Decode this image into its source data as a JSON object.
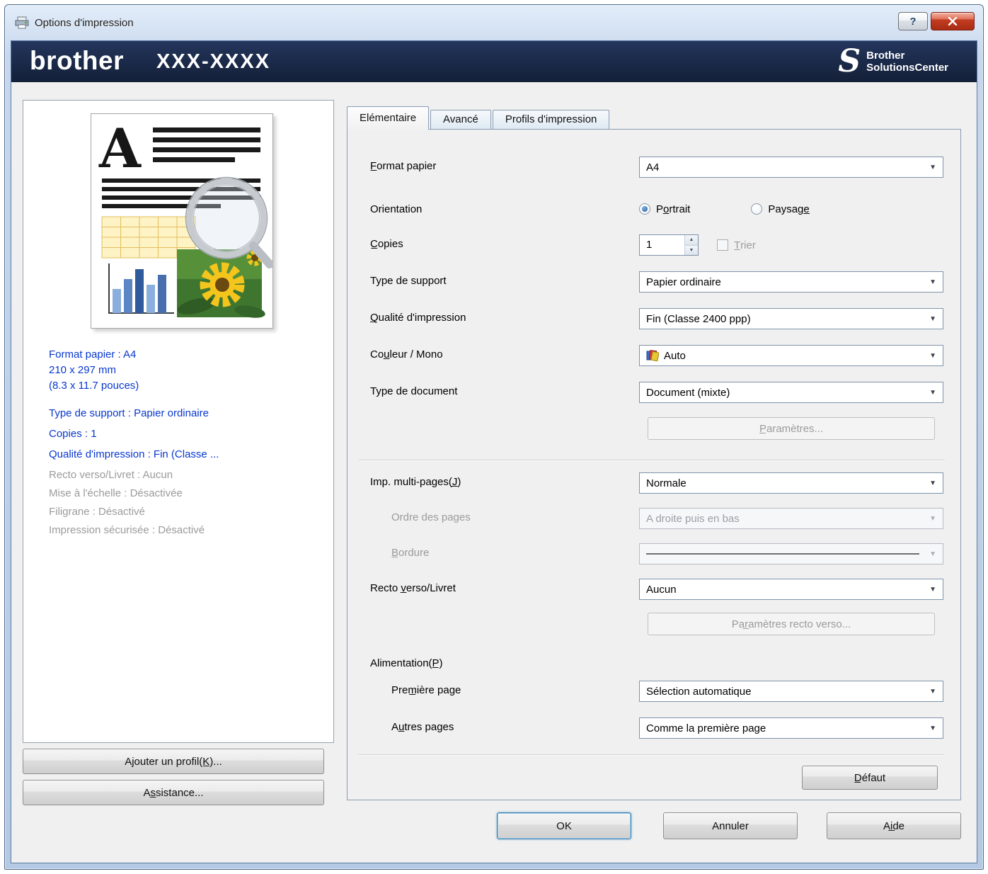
{
  "window": {
    "title": "Options d'impression",
    "help_glyph": "?"
  },
  "icons": {
    "close": "✕",
    "chevron_down": "▼",
    "spinner_up": "▲",
    "spinner_down": "▼"
  },
  "header": {
    "brand": "brother",
    "model": "XXX-XXXX",
    "s_mark": "S",
    "solutions_line1": "Brother",
    "solutions_line2": "SolutionsCenter",
    "band_color": "#1a2948"
  },
  "preview": {
    "info": [
      {
        "text": "Format papier : A4",
        "muted": false
      },
      {
        "text": "210 x 297 mm",
        "muted": false
      },
      {
        "text": "(8.3 x 11.7 pouces)",
        "muted": false
      },
      {
        "text": "Type de support : Papier ordinaire",
        "muted": false
      },
      {
        "text": "Copies : 1",
        "muted": false
      },
      {
        "text": "Qualité d'impression : Fin (Classe ...",
        "muted": false
      },
      {
        "text": "Recto verso/Livret : Aucun",
        "muted": true
      },
      {
        "text": "Mise à l'échelle : Désactivée",
        "muted": true
      },
      {
        "text": "Filigrane : Désactivé",
        "muted": true
      },
      {
        "text": "Impression sécurisée : Désactivé",
        "muted": true
      }
    ]
  },
  "left_buttons": {
    "add_profile": "Ajouter un profil(K̲)...",
    "assistance": "As̲sistance..."
  },
  "tabs": [
    {
      "label": "Elémentaire",
      "active": true
    },
    {
      "label": "Avancé",
      "active": false
    },
    {
      "label": "Profils d'impression",
      "active": false
    }
  ],
  "form": {
    "format_papier_label": "F̲ormat papier",
    "format_papier_value": "A4",
    "orientation_label": "Orientation",
    "portrait_label": "Po̲rtrait",
    "paysage_label": "Paysage̲",
    "orientation_selected": "Portrait",
    "copies_label": "C̲opies",
    "copies_value": "1",
    "trier_label": "T̲rier",
    "type_support_label": "Type de support",
    "type_support_value": "Papier ordinaire",
    "qualite_label": "Q̲ualité d'impression",
    "qualite_value": "Fin (Classe 2400 ppp)",
    "couleur_label": "Cou̲leur / Mono",
    "couleur_value": "Auto",
    "type_document_label": "Type de document",
    "type_document_value": "Document (mixte)",
    "parametres_button": "P̲aramètres...",
    "multi_pages_label": "Imp. multi-pages(J̲)",
    "multi_pages_value": "Normale",
    "ordre_pages_label": "Ordre des pages",
    "ordre_pages_value": "A droite puis en bas",
    "bordure_label": "B̲ordure",
    "recto_verso_label": "Recto v̲erso/Livret",
    "recto_verso_value": "Aucun",
    "parametres_rv_button": "Par̲amètres recto verso...",
    "alimentation_label": "Alimentation(P̲)",
    "premiere_page_label": "Prem̲ière page",
    "premiere_page_value": "Sélection automatique",
    "autres_pages_label": "Au̲tres pages",
    "autres_pages_value": "Comme la première page",
    "defaut_button": "D̲éfaut"
  },
  "footer": {
    "ok": "OK",
    "annuler": "Annuler",
    "aide": "Ai̲de"
  }
}
